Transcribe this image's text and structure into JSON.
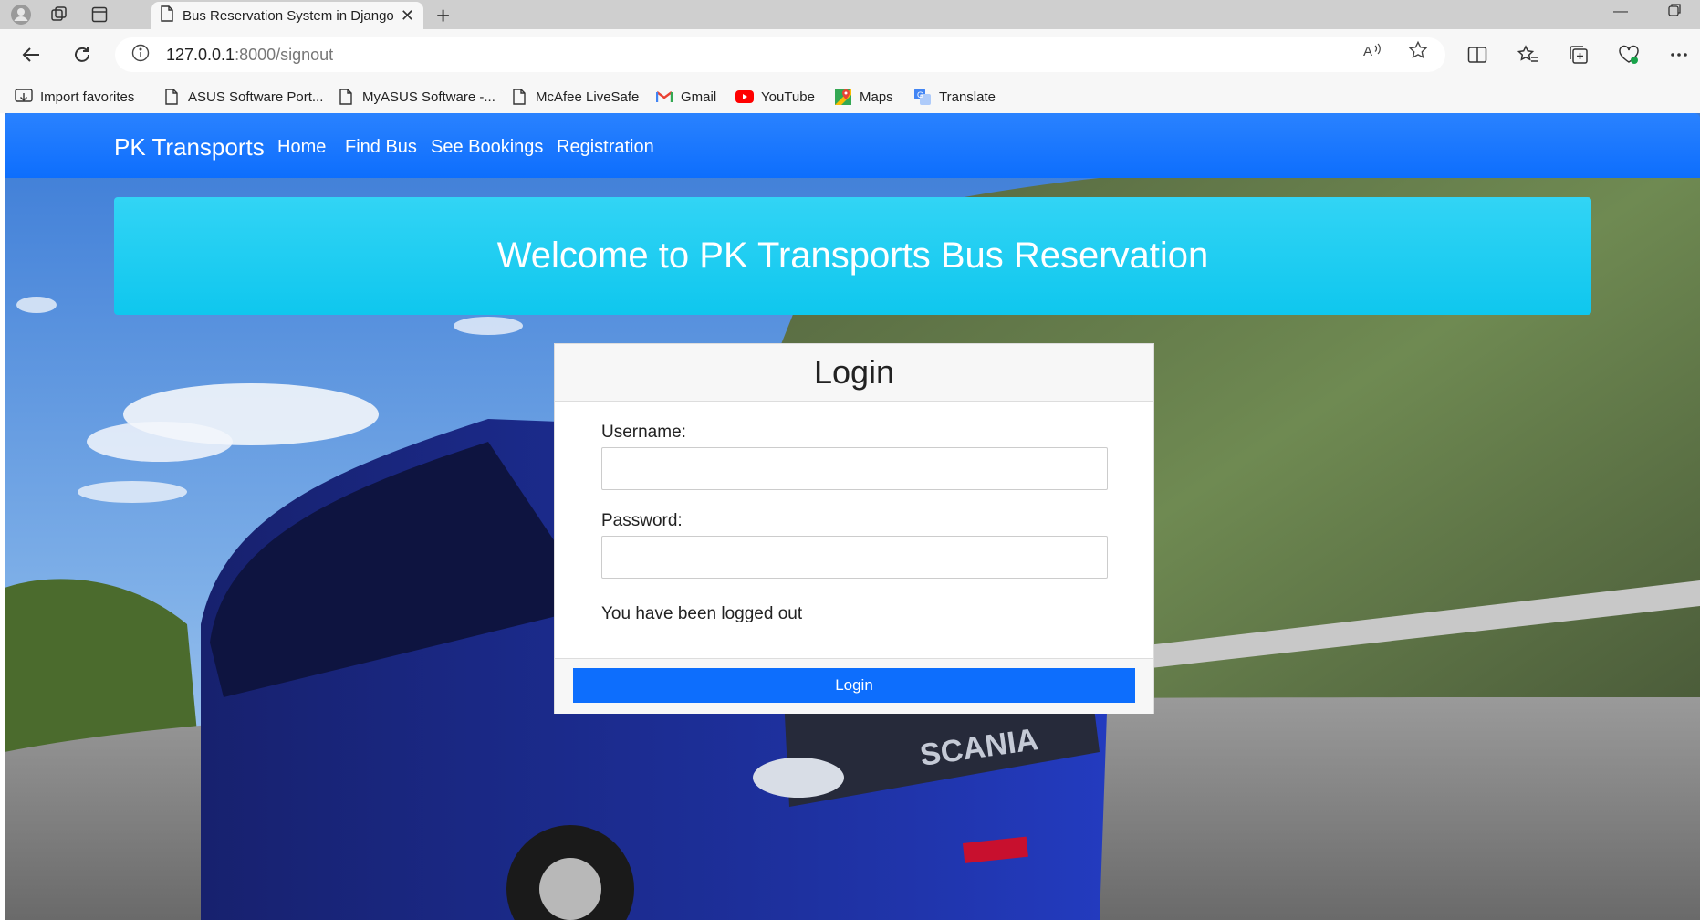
{
  "browser": {
    "tab_title": "Bus Reservation System in Django",
    "url_host": "127.0.0.1",
    "url_rest": ":8000/signout",
    "favorites": [
      {
        "label": "Import favorites",
        "icon": "import-icon"
      },
      {
        "label": "ASUS Software Port...",
        "icon": "page-icon"
      },
      {
        "label": "MyASUS Software -...",
        "icon": "page-icon"
      },
      {
        "label": "McAfee LiveSafe",
        "icon": "page-icon"
      },
      {
        "label": "Gmail",
        "icon": "gmail-icon"
      },
      {
        "label": "YouTube",
        "icon": "youtube-icon"
      },
      {
        "label": "Maps",
        "icon": "maps-icon"
      },
      {
        "label": "Translate",
        "icon": "translate-icon"
      }
    ]
  },
  "navbar": {
    "brand": "PK Transports",
    "links": [
      "Home",
      "Find Bus",
      "See Bookings",
      "Registration"
    ]
  },
  "welcome": {
    "title": "Welcome to PK Transports Bus Reservation"
  },
  "login": {
    "title": "Login",
    "username_label": "Username:",
    "username_value": "",
    "password_label": "Password:",
    "password_value": "",
    "message": "You have been logged out",
    "button": "Login"
  },
  "colors": {
    "navbar": "#0d6efd",
    "welcome": "#1dcaf0",
    "button": "#0d6efd"
  }
}
